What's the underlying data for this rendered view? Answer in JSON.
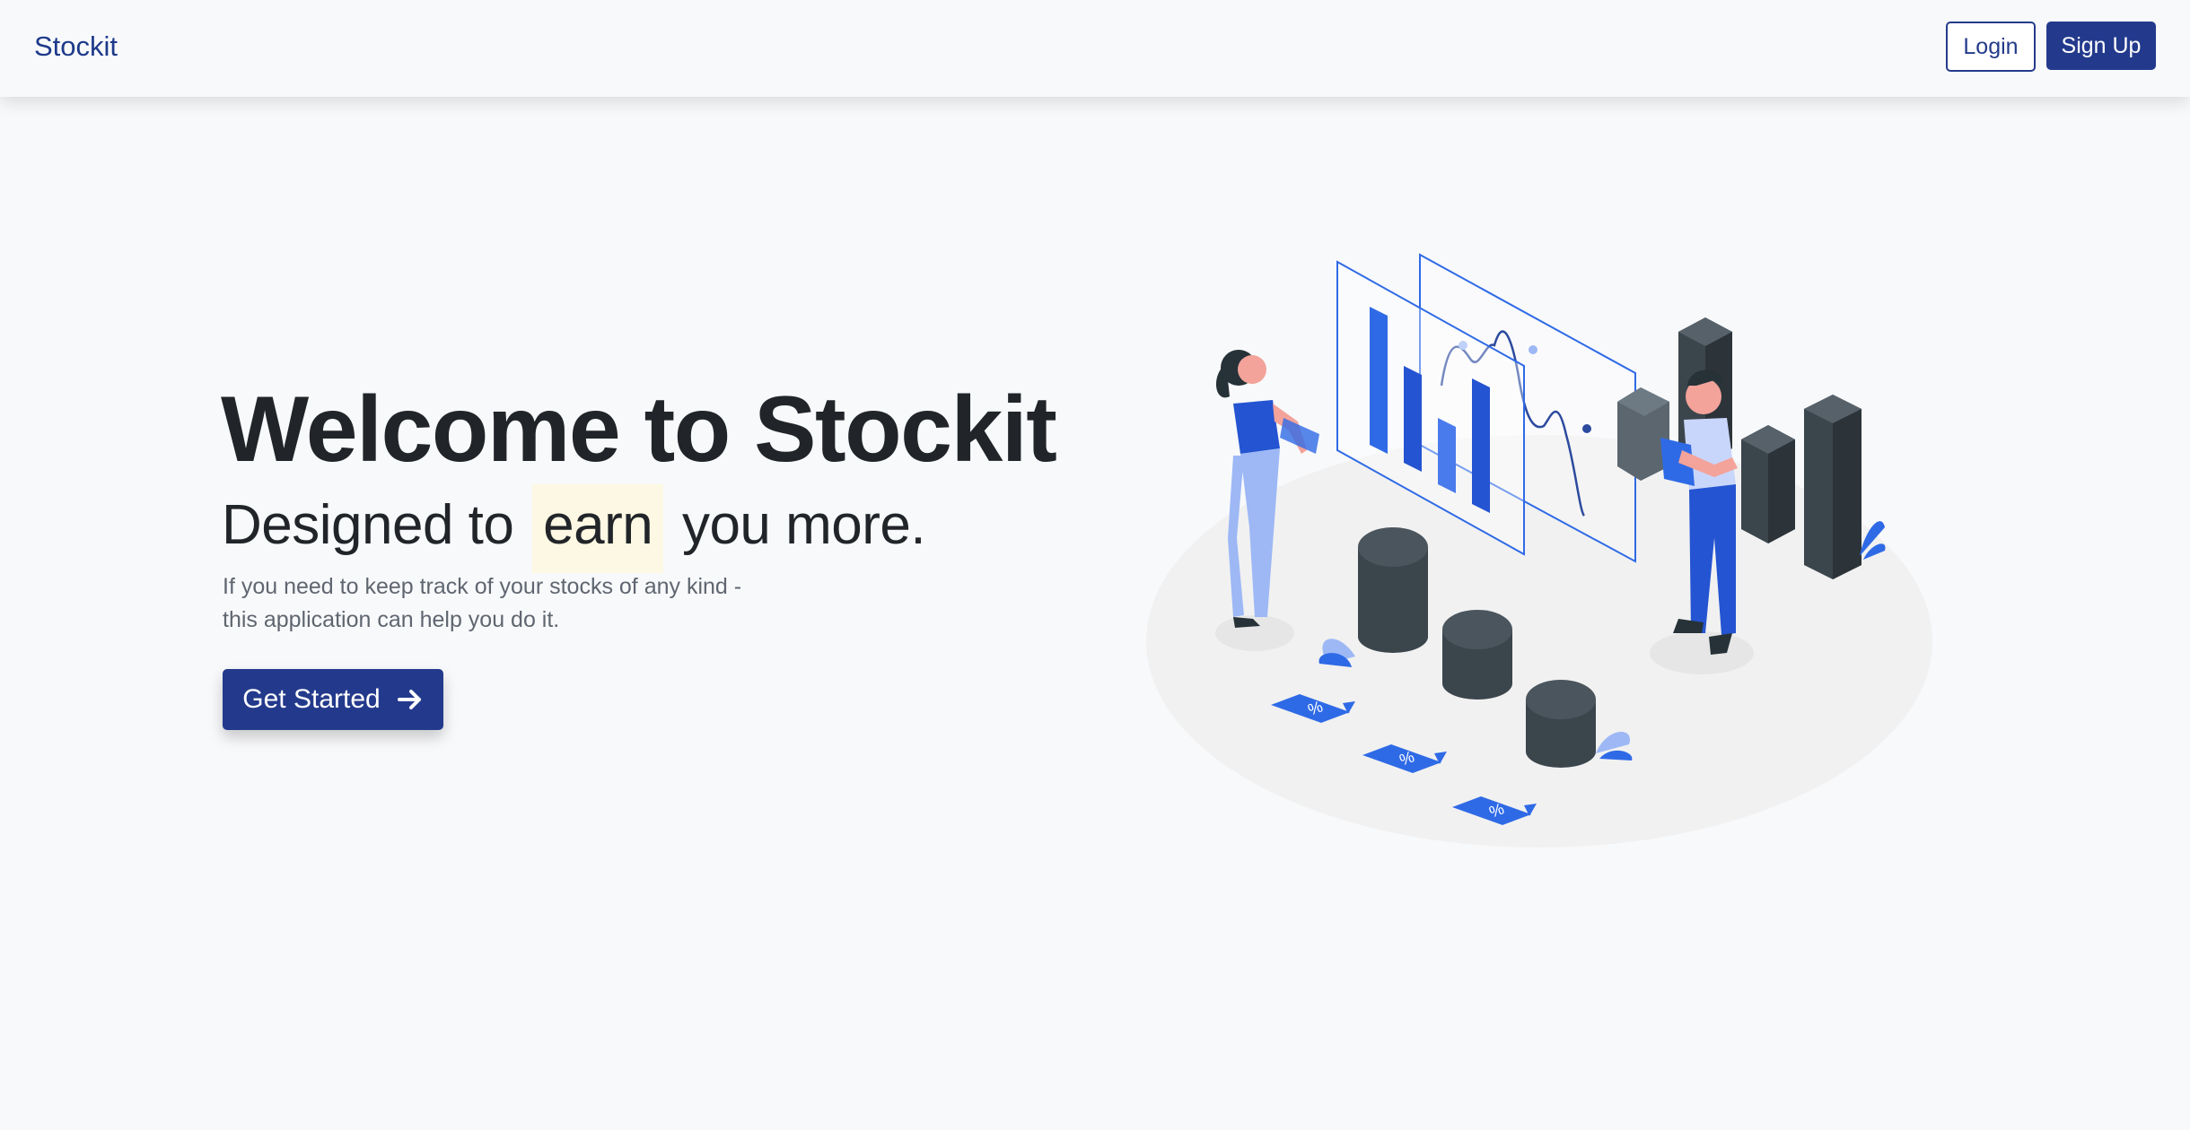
{
  "navbar": {
    "brand": "Stockit",
    "login_label": "Login",
    "signup_label": "Sign Up"
  },
  "hero": {
    "title": "Welcome to Stockit",
    "subtitle_before": "Designed to",
    "subtitle_highlight": "earn",
    "subtitle_after": "you more.",
    "description_line1": "If you need to keep track of your stocks of any kind -",
    "description_line2": "this application can help you do it.",
    "cta_label": "Get Started",
    "cta_icon": "arrow-right-icon"
  },
  "illustration": {
    "name": "stock-analytics-illustration",
    "colors": {
      "primary_blue": "#2f6ae6",
      "light_blue": "#9db8f5",
      "dark_slate": "#3b454c",
      "floor": "#f1f1f1"
    }
  },
  "colors": {
    "brand": "#233a8c",
    "background": "#f8f9fb",
    "highlight": "#fdf8e3",
    "text_dark": "#212529",
    "text_muted": "#5f6670"
  }
}
